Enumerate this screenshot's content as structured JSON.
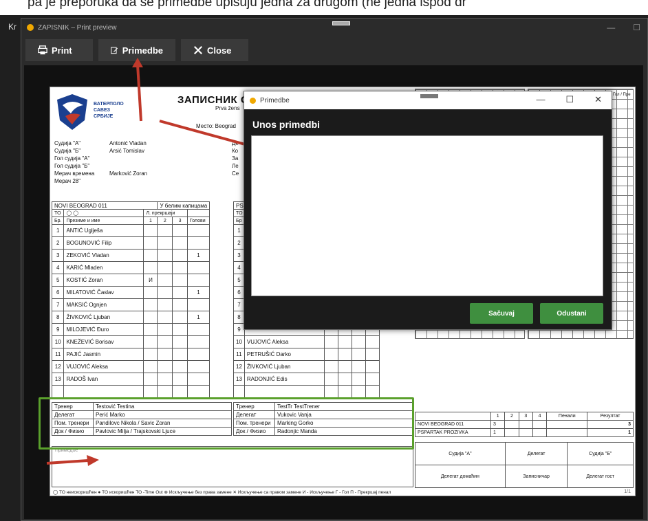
{
  "instruction_text": "pa je preporuka da se primedbe upisuju jedna za drugom (ne jedna ispod dr",
  "bg_app_label": "Kr",
  "print_window": {
    "title": "ZAPISNIK – Print preview",
    "toolbar": {
      "print_label": "Print",
      "primedbe_label": "Primedbe",
      "close_label": "Close"
    },
    "minimize": "—",
    "maximize": "☐"
  },
  "paper": {
    "logo_text": [
      "ВАТЕРПОЛО",
      "САВЕЗ",
      "СРБИЈЕ"
    ],
    "title": "ЗАПИСНИК С",
    "subtitle": "Prva žens",
    "location_label": "Место: Beograd",
    "officials": [
      {
        "label": "Судија \"А\"",
        "value": "Antonić Vladan"
      },
      {
        "label": "Судија \"Б\"",
        "value": "Arsić Tomislav"
      },
      {
        "label": "Гол судија \"А\"",
        "value": ""
      },
      {
        "label": "Гол судија \"Б\"",
        "value": ""
      },
      {
        "label": "Мерач времена",
        "value": "Marković Zoran"
      },
      {
        "label": "Мерач 28\"",
        "value": ""
      }
    ],
    "right_officials_initials": [
      "Де",
      "Ко",
      "За",
      "Ле",
      "Се"
    ],
    "team_a": {
      "name": "NOVI BEOGRAD 011",
      "cap_label": "У белим капицама",
      "to_label": "TO",
      "br_label": "Бр.",
      "name_header": "Презиме и име",
      "fouls_header": "Л. прекршаји",
      "periods": [
        "1",
        "2",
        "3"
      ],
      "goals_header": "Голови",
      "players": [
        {
          "no": "1",
          "name": "ANTIĆ Uglješa",
          "f1": "",
          "goals": ""
        },
        {
          "no": "2",
          "name": "BOGUNOVIĆ Filip",
          "f1": "",
          "goals": ""
        },
        {
          "no": "3",
          "name": "ZEKOVIĆ Vladan",
          "f1": "",
          "goals": "1"
        },
        {
          "no": "4",
          "name": "KARIĆ Mladen",
          "f1": "",
          "goals": ""
        },
        {
          "no": "5",
          "name": "KOSTIĆ Zoran",
          "f1": "И",
          "goals": ""
        },
        {
          "no": "6",
          "name": "MILATOVIĆ Časlav",
          "f1": "",
          "goals": "1"
        },
        {
          "no": "7",
          "name": "MAKSIĆ Ognjen",
          "f1": "",
          "goals": ""
        },
        {
          "no": "8",
          "name": "ŽIVKOVIĆ Ljuban",
          "f1": "",
          "goals": "1"
        },
        {
          "no": "9",
          "name": "MILOJEVIĆ Đuro",
          "f1": "",
          "goals": ""
        },
        {
          "no": "10",
          "name": "KNEŽEVIĆ Borisav",
          "f1": "",
          "goals": ""
        },
        {
          "no": "11",
          "name": "PAJIĆ Jasmin",
          "f1": "",
          "goals": ""
        },
        {
          "no": "12",
          "name": "VUJOVIĆ Aleksa",
          "f1": "",
          "goals": ""
        },
        {
          "no": "13",
          "name": "RADOŠ Ivan",
          "f1": "",
          "goals": ""
        }
      ]
    },
    "team_b": {
      "name_prefix": "PS",
      "to_label": "TO",
      "br_label": "Бр",
      "players": [
        {
          "no": "1",
          "name": ""
        },
        {
          "no": "2",
          "name": ""
        },
        {
          "no": "3",
          "name": ""
        },
        {
          "no": "4",
          "name": ""
        },
        {
          "no": "5",
          "name": ""
        },
        {
          "no": "6",
          "name": ""
        },
        {
          "no": "7",
          "name": ""
        },
        {
          "no": "8",
          "name": ""
        },
        {
          "no": "9",
          "name": ""
        },
        {
          "no": "10",
          "name": "VUJOVIĆ Aleksa"
        },
        {
          "no": "11",
          "name": "PETRUŠIĆ Darko"
        },
        {
          "no": "12",
          "name": "ŽIVKOVIĆ Ljuban"
        },
        {
          "no": "13",
          "name": "RADONJIĆ Edis"
        }
      ]
    },
    "staff_a": [
      {
        "role": "Тренер",
        "name": "Testović Testina"
      },
      {
        "role": "Делегат",
        "name": "Perić Marko"
      },
      {
        "role": "Пом. тренери",
        "name": "Pandilovc Nikola / Savic Zoran"
      },
      {
        "role": "Док / Физио",
        "name": "Pavlovic Milja / Trajskovski Ljuce"
      }
    ],
    "staff_b": [
      {
        "role": "Тренер",
        "name": "TestTr TestTrener"
      },
      {
        "role": "Делегат",
        "name": "Vukovic Vanja"
      },
      {
        "role": "Пом. тренери",
        "name": "Marking Gorko"
      },
      {
        "role": "Док / Физио",
        "name": "Radonjic Manda"
      }
    ],
    "notes_label": "Примедбе",
    "legend": "◯ TO неискоришћен    ● TO искоришћен    TO -Time Out    ⊗ Искључење без права замене    ✕ Искључење са правом замене    И - Искључење    Г - Гол    П - Прекршај пенал",
    "page_num": "1/1",
    "right_header": "Гол / Пре",
    "score": {
      "headers": [
        "",
        "1",
        "2",
        "3",
        "4",
        "Пенали",
        "Резултат"
      ],
      "rows": [
        {
          "team": "NOVI BEOGRAD 011",
          "p1": "3",
          "result": "3"
        },
        {
          "team": "PSPARTAK PROZIVKA",
          "p1": "1",
          "result": "1"
        }
      ]
    },
    "signatures": [
      "Судија \"А\"",
      "Делегат",
      "Судија \"Б\"",
      "Делегат домаћин",
      "Записничар",
      "Делегат гост"
    ]
  },
  "modal": {
    "title": "Primedbe",
    "header": "Unos primedbi",
    "text_value": "",
    "save_label": "Sačuvaj",
    "cancel_label": "Odustani",
    "minimize": "—",
    "maximize": "☐",
    "close": "✕"
  },
  "colors": {
    "green": "#5aa02c",
    "button_green": "#3f8f3f",
    "arrow_red": "#c0392b",
    "logo_blue": "#1a3f8f",
    "accent_orange": "#f0a800"
  }
}
